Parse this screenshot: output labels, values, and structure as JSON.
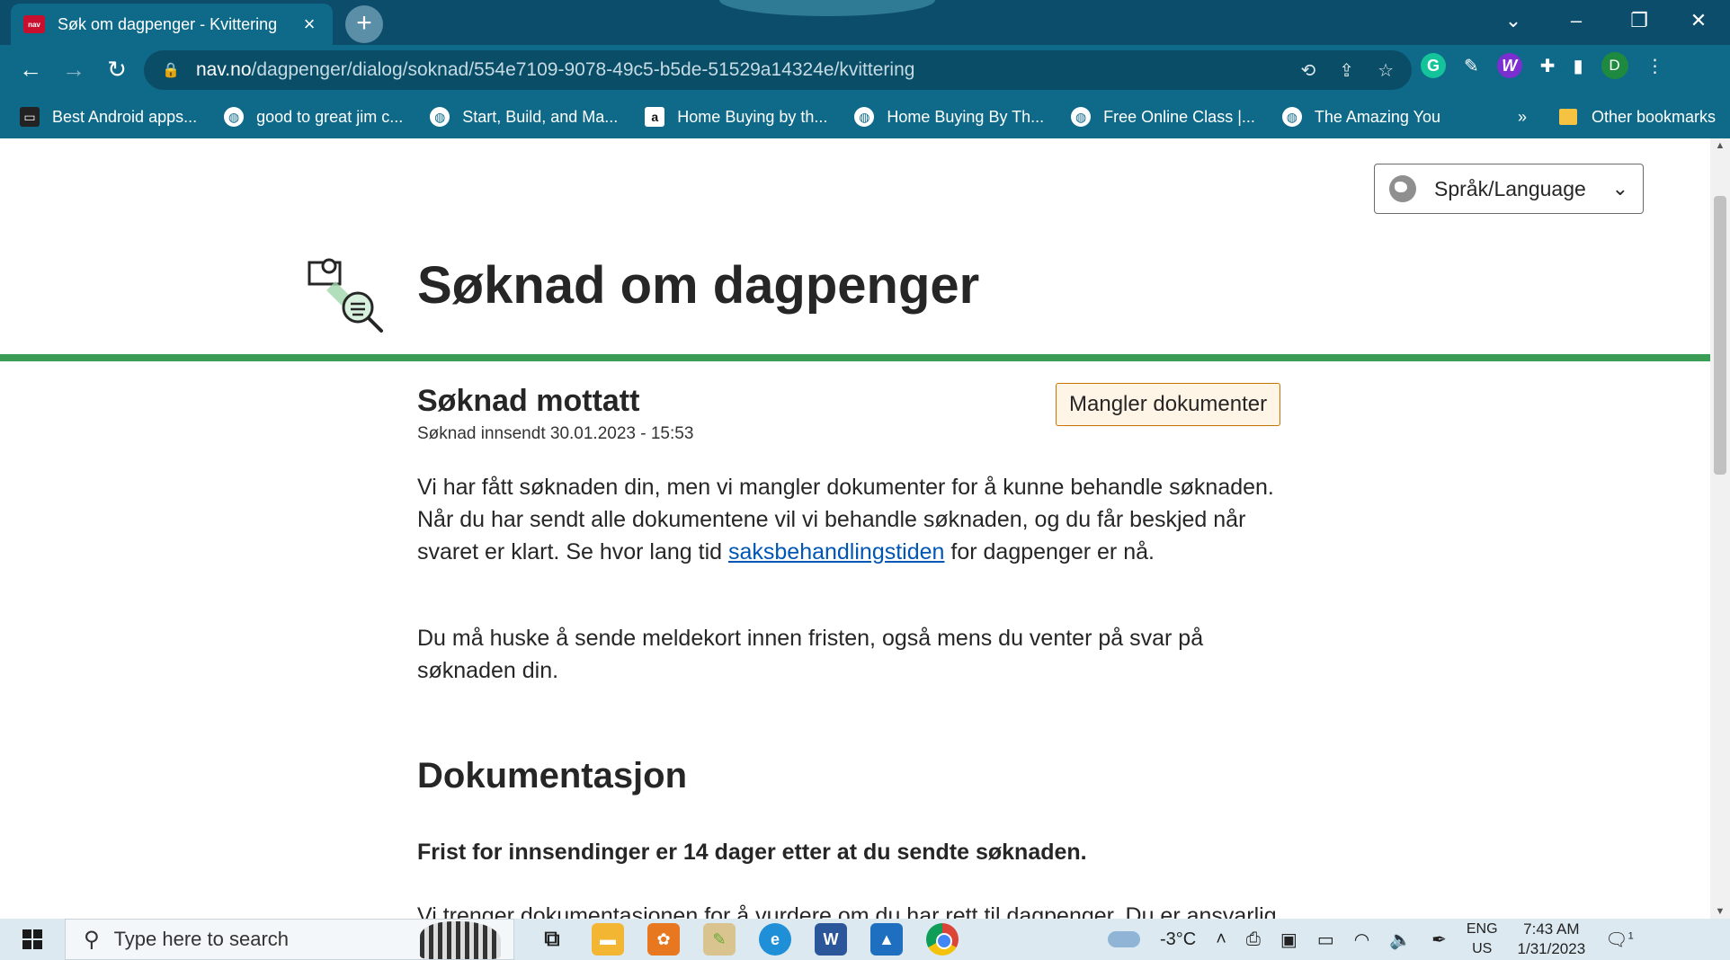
{
  "browser": {
    "tab_title": "Søk om dagpenger - Kvittering",
    "favicon_text": "nav",
    "url_host": "nav.no",
    "url_path": "/dagpenger/dialog/soknad/554e7109-9078-49c5-b5de-51529a14324e/kvittering",
    "profile_initial": "D",
    "grammarly_letter": "G",
    "ext_w_letter": "W",
    "bookmarks": [
      {
        "label": "Best Android apps...",
        "icon": "tablet-icon"
      },
      {
        "label": "good to great jim c...",
        "icon": "globe-icon"
      },
      {
        "label": "Start, Build, and Ma...",
        "icon": "globe-icon"
      },
      {
        "label": "Home Buying by th...",
        "icon": "amazon-icon"
      },
      {
        "label": "Home Buying By Th...",
        "icon": "globe-icon"
      },
      {
        "label": "Free Online Class |...",
        "icon": "globe-icon"
      },
      {
        "label": "The Amazing You",
        "icon": "globe-icon"
      }
    ],
    "bookmarks_more": "»",
    "other_bookmarks": "Other bookmarks"
  },
  "page": {
    "language_selector": "Språk/Language",
    "hero_title": "Søknad om dagpenger",
    "receipt_title": "Søknad mottatt",
    "receipt_date": "Søknad innsendt 30.01.2023 - 15:53",
    "status_tag": "Mangler dokumenter",
    "para1_before": "Vi har fått søknaden din, men vi mangler dokumenter for å kunne behandle søknaden. Når du har sendt alle dokumentene vil vi behandle søknaden, og du får beskjed når svaret er klart. Se hvor lang tid ",
    "para1_link": "saksbehandlingstiden",
    "para1_after": " for dagpenger er nå.",
    "para2": "Du må huske å sende meldekort innen fristen, også mens du venter på svar på søknaden din.",
    "section_title": "Dokumentasjon",
    "deadline": "Frist for innsendinger er 14 dager etter at du sendte søknaden.",
    "para3": "Vi trenger dokumentasjonen for å vurdere om du har rett til dagpenger. Du er ansvarlig"
  },
  "taskbar": {
    "search_placeholder": "Type here to search",
    "weather": "-3°C",
    "language_line1": "ENG",
    "language_line2": "US",
    "time": "7:43 AM",
    "date": "1/31/2023",
    "notification_count": "1"
  },
  "colors": {
    "chrome_bg": "#0e6a88",
    "accent_green": "#3b9c55",
    "link_blue": "#0056b4",
    "tag_border": "#c77300"
  }
}
